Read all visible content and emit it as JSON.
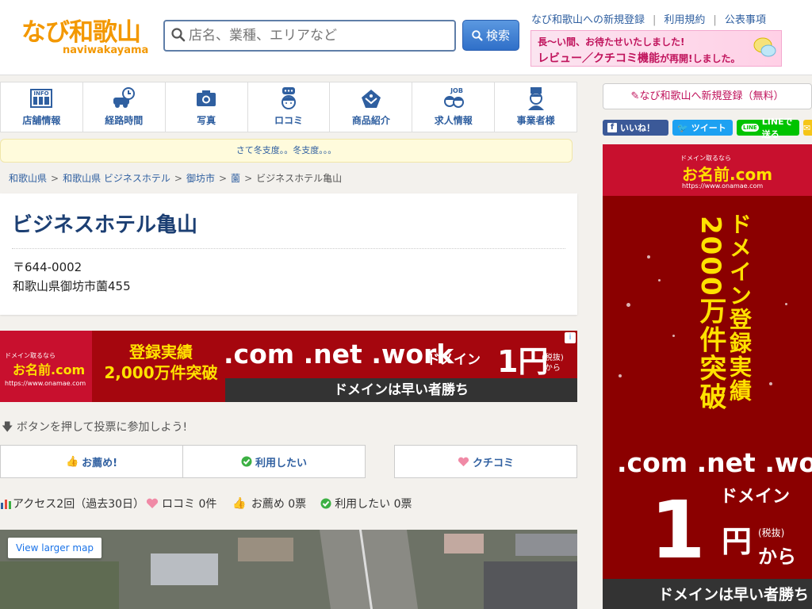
{
  "header": {
    "logo_text": "なび和歌山",
    "logo_sub": "naviwakayama",
    "search_placeholder": "店名、業種、エリアなど",
    "search_button": "検索",
    "links": [
      "なび和歌山への新規登録",
      "利用規約",
      "公表事項"
    ],
    "review_banner": {
      "line1": "長〜い間、お待たせいたしました!",
      "line2_a": "レビュー／クチコミ機能",
      "line2_b": "が再開!",
      "line2_c": "しました。"
    }
  },
  "nav": {
    "items": [
      {
        "label": "店舗情報",
        "icon": "info-icon"
      },
      {
        "label": "経路時間",
        "icon": "car-clock-icon"
      },
      {
        "label": "写真",
        "icon": "camera-icon"
      },
      {
        "label": "ロコミ",
        "icon": "speech-person-icon"
      },
      {
        "label": "商品紹介",
        "icon": "product-icon"
      },
      {
        "label": "求人情報",
        "icon": "job-icon"
      },
      {
        "label": "事業者様",
        "icon": "business-person-icon"
      }
    ]
  },
  "notice": "さて冬支度。。冬支度。。。",
  "breadcrumb": [
    "和歌山県",
    "和歌山県 ビジネスホテル",
    "御坊市",
    "薗",
    "ビジネスホテル亀山"
  ],
  "listing": {
    "name": "ビジネスホテル亀山",
    "zip": "〒644-0002",
    "address": "和歌山県御坊市薗455"
  },
  "ad_banner": {
    "brand_small": "ドメイン取るなら",
    "brand": "お名前.com",
    "brand_url": "https://www.onamae.com",
    "achievement": "登録実績\n2,000万件突破",
    "tlds": ".com .net .work",
    "domain_word": "ドメイン",
    "price": "1円",
    "tax": "(税抜)\nから",
    "tagline": "ドメインは早い者勝ち",
    "info_icon": "i"
  },
  "vote": {
    "prompt": "ボタンを押して投票に参加しよう!",
    "recommend_button": "お薦め!",
    "want_to_use_button": "利用したい",
    "review_button": "クチコミ"
  },
  "stats": {
    "access": "アクセス2回（過去30日）",
    "reviews": "ロコミ 0件",
    "recommend": "お薦め 0票",
    "want_to_use": "利用したい 0票"
  },
  "map": {
    "link": "View larger map"
  },
  "sidebar": {
    "signup": "なび和歌山へ新規登録（無料）",
    "social": [
      {
        "label": "いいね！",
        "color": "#3b5998"
      },
      {
        "label": "ツイート",
        "color": "#1da1f2"
      },
      {
        "label": "LINEで送る",
        "color": "#00c300"
      }
    ],
    "ad": {
      "brand_small": "ドメイン取るなら",
      "brand": "お名前.com",
      "brand_url": "https://www.onamae.com",
      "vertical_1": "ドメイン登録実績",
      "vertical_2": "2000万件突破",
      "tlds": ".com .net .work",
      "domain_word": "ドメイン",
      "price_num": "1",
      "price_unit": "円",
      "tax": "(税抜)",
      "kara": "から",
      "tagline": "ドメインは早い者勝ち"
    }
  },
  "colors": {
    "accent": "#f39800",
    "link": "#2f5fa0",
    "title": "#1c3f73",
    "ad_red": "#c8102e"
  }
}
